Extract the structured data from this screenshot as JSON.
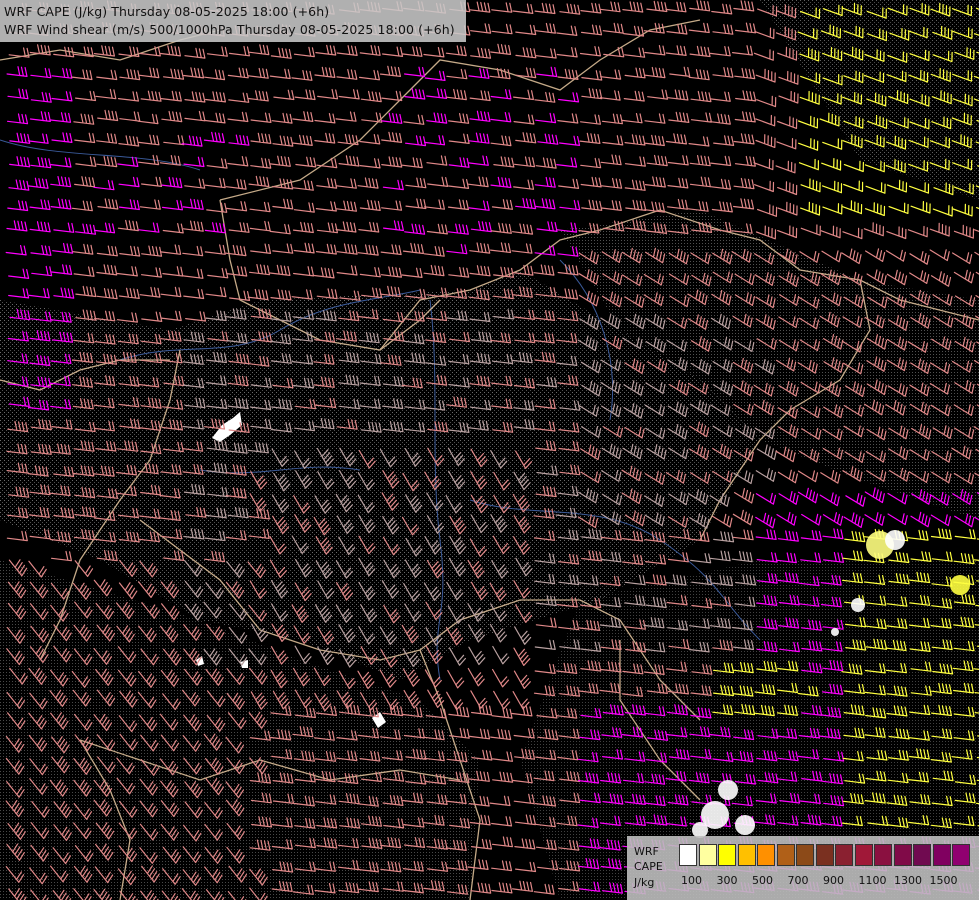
{
  "title": {
    "line1": "WRF CAPE (J/kg) Thursday 08-05-2025 18:00 (+6h)",
    "line2": "WRF Wind shear (m/s) 500/1000hPa Thursday 08-05-2025 18:00 (+6h)"
  },
  "legend": {
    "model": "WRF",
    "field": "CAPE",
    "unit": "J/kg",
    "ticks": [
      "100",
      "300",
      "500",
      "700",
      "900",
      "1100",
      "1300",
      "1500"
    ],
    "colors": [
      "#ffffff",
      "#ffffa0",
      "#ffff00",
      "#ffc000",
      "#ff9000",
      "#b06018",
      "#8c4a18",
      "#7a3020",
      "#8a2030",
      "#a01838",
      "#8a1040",
      "#800a48",
      "#700a50",
      "#800060",
      "#900070"
    ]
  },
  "colors": {
    "background": "#000000",
    "barb_default": "#e08888",
    "barb_grey": "#b8a0a0",
    "barb_magenta": "#ff00ff",
    "barb_yellow": "#ffff40",
    "border": "#e8c8a0",
    "river": "#3a5a9a"
  }
}
